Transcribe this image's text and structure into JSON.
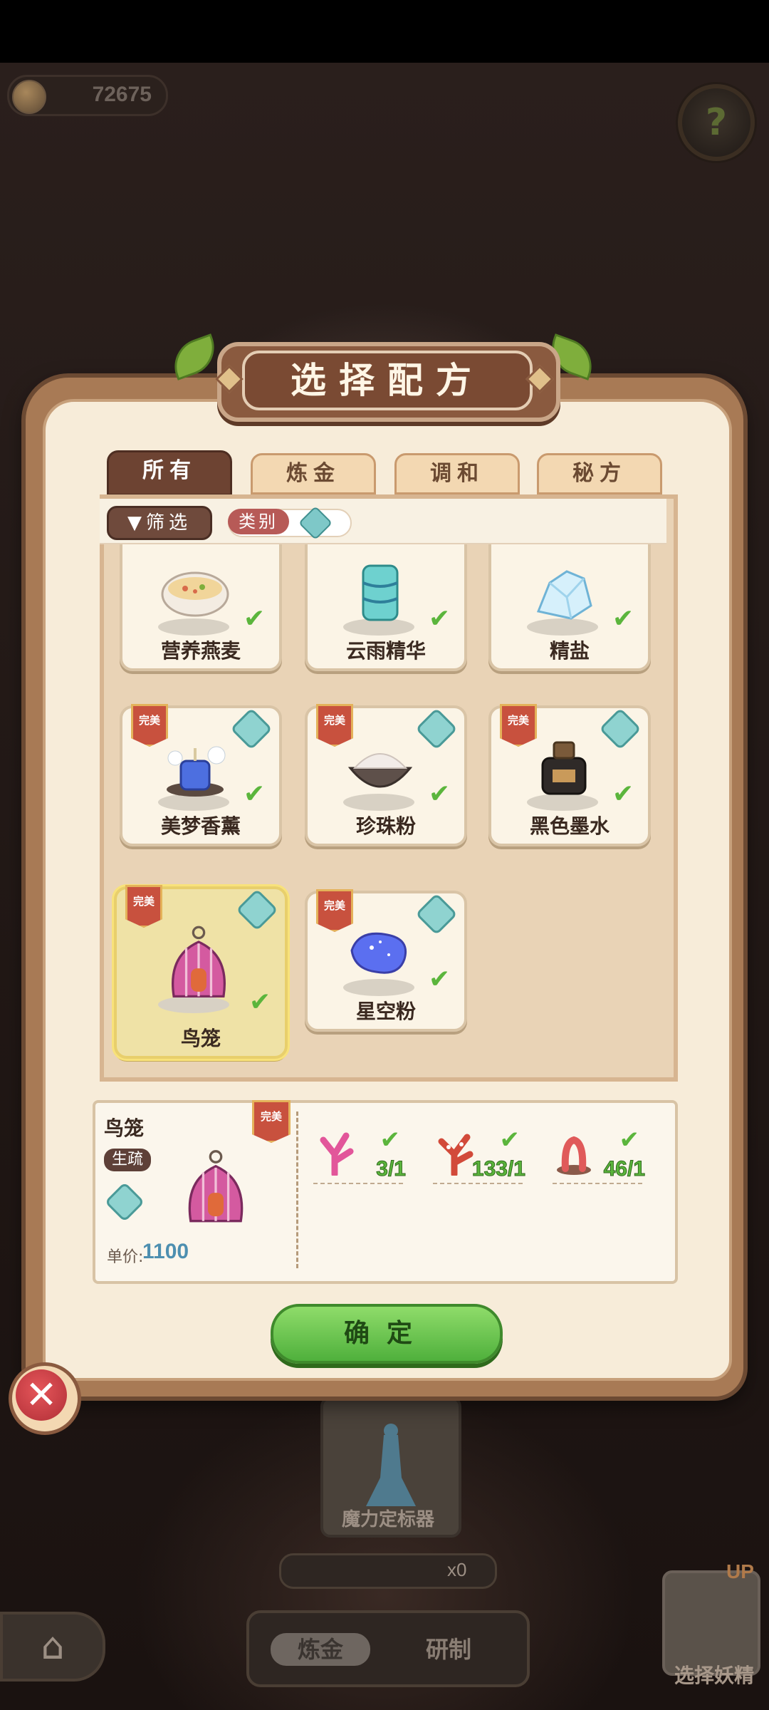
{
  "currency": {
    "amount": "72675"
  },
  "help": {
    "icon": "leaf-help-icon"
  },
  "dialog": {
    "title": "选择配方",
    "tabs": [
      "所有",
      "炼金",
      "调和",
      "秘方"
    ],
    "active_tab": "所有",
    "filter": {
      "filter_label": "筛选",
      "category_label": "类别"
    },
    "recipes": [
      {
        "name": "营养燕麦",
        "icon": "oatmeal-bowl-icon",
        "ready": true
      },
      {
        "name": "云雨精华",
        "icon": "cloud-rain-jar-icon",
        "ready": true
      },
      {
        "name": "精盐",
        "icon": "salt-crystal-icon",
        "ready": true
      },
      {
        "name": "美梦香薰",
        "icon": "aroma-candle-icon",
        "badge": "完美",
        "ready": true
      },
      {
        "name": "珍珠粉",
        "icon": "pearl-powder-bowl-icon",
        "badge": "完美",
        "ready": true
      },
      {
        "name": "黑色墨水",
        "icon": "ink-bottle-icon",
        "badge": "完美",
        "ready": true
      },
      {
        "name": "鸟笼",
        "icon": "birdcage-icon",
        "badge": "完美",
        "ready": true,
        "selected": true
      },
      {
        "name": "星空粉",
        "icon": "starry-powder-icon",
        "badge": "完美",
        "ready": true
      }
    ],
    "detail": {
      "name": "鸟笼",
      "tag": "生疏",
      "badge": "完美",
      "price_label": "单价:",
      "price": "1100",
      "ingredients": [
        {
          "icon": "pink-coral-icon",
          "count": "3/1"
        },
        {
          "icon": "red-white-coral-icon",
          "count": "133/1"
        },
        {
          "icon": "red-worm-coral-icon",
          "count": "46/1"
        }
      ]
    },
    "confirm_label": "确定"
  },
  "background": {
    "card_label": "魔力定标器",
    "counter": "x0",
    "tabs": [
      "炼金",
      "研制"
    ],
    "fairy_label": "选择妖精",
    "fairy_up": "UP"
  },
  "colors": {
    "accent_green": "#5bb53c",
    "panel_brown": "#8a5a3f",
    "price_blue": "#4d8fb0"
  }
}
